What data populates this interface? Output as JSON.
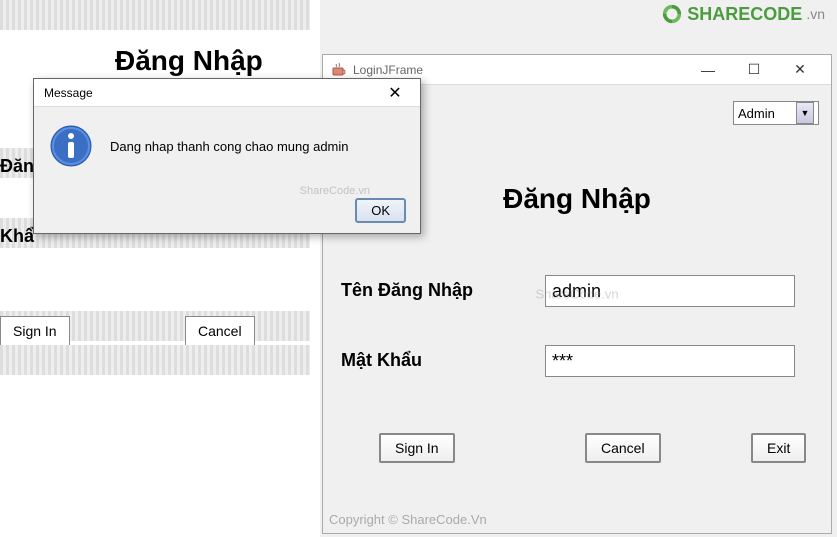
{
  "logo": {
    "text": "SHARECODE",
    "suffix": ".vn"
  },
  "background": {
    "title": "Đăng Nhập",
    "label_username_partial": "Đăn",
    "label_password_partial": "Khẩ",
    "signin": "Sign In",
    "cancel": "Cancel"
  },
  "login_frame": {
    "window_title": "LoginJFrame",
    "role_selected": "Admin",
    "heading": "Đăng Nhập",
    "label_username": "Tên Đăng Nhập",
    "label_password": "Mật Khẩu",
    "value_username": "admin",
    "value_password": "***",
    "btn_signin": "Sign In",
    "btn_cancel": "Cancel",
    "btn_exit": "Exit",
    "copyright": "Copyright © ShareCode.Vn",
    "watermark": "ShareCode.vn"
  },
  "message": {
    "title": "Message",
    "text": "Dang nhap thanh cong chao mung admin",
    "ok": "OK",
    "watermark": "ShareCode.vn"
  },
  "titlebar_controls": {
    "minimize": "—",
    "maximize": "☐",
    "close": "✕"
  }
}
